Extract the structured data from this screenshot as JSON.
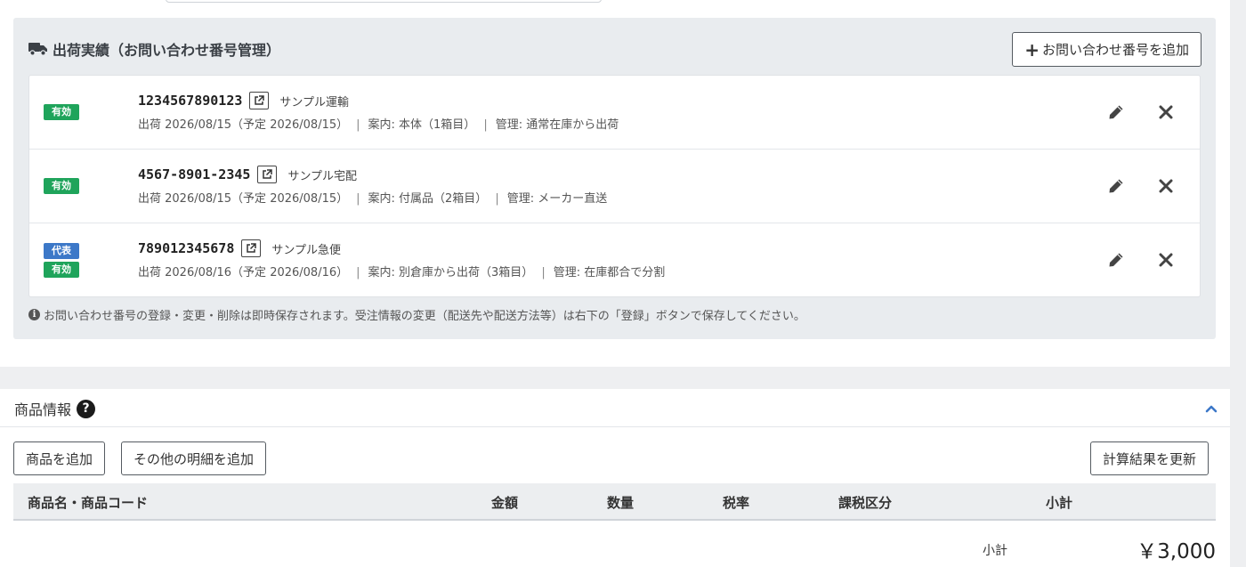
{
  "shipments": {
    "title": "出荷実績（お問い合わせ番号管理）",
    "add_button": "お問い合わせ番号を追加",
    "rows": [
      {
        "badges": [
          "有効"
        ],
        "tracking_no": "1234567890123",
        "carrier": "サンプル運輸",
        "shipped": "出荷 2026/08/15（予定 2026/08/15）",
        "guide": "案内: 本体（1箱目）",
        "manage": "管理: 通常在庫から出荷"
      },
      {
        "badges": [
          "有効"
        ],
        "tracking_no": "4567-8901-2345",
        "carrier": "サンプル宅配",
        "shipped": "出荷 2026/08/15（予定 2026/08/15）",
        "guide": "案内: 付属品（2箱目）",
        "manage": "管理: メーカー直送"
      },
      {
        "badges": [
          "代表",
          "有効"
        ],
        "tracking_no": "789012345678",
        "carrier": "サンプル急便",
        "shipped": "出荷 2026/08/16（予定 2026/08/16）",
        "guide": "案内: 別倉庫から出荷（3箱目）",
        "manage": "管理: 在庫都合で分割"
      }
    ],
    "note": "お問い合わせ番号の登録・変更・削除は即時保存されます。受注情報の変更（配送先や配送方法等）は右下の「登録」ボタンで保存してください。"
  },
  "products": {
    "title": "商品情報",
    "add_product": "商品を追加",
    "add_other": "その他の明細を追加",
    "recalc": "計算結果を更新",
    "columns": [
      "商品名・商品コード",
      "金額",
      "数量",
      "税率",
      "課税区分",
      "小計"
    ],
    "subtotal_label": "小計",
    "subtotal_value": "￥3,000"
  },
  "colors": {
    "valid_badge": "#1fa45b",
    "primary_badge": "#3c78c8",
    "panel_bg": "#e9ecef"
  }
}
